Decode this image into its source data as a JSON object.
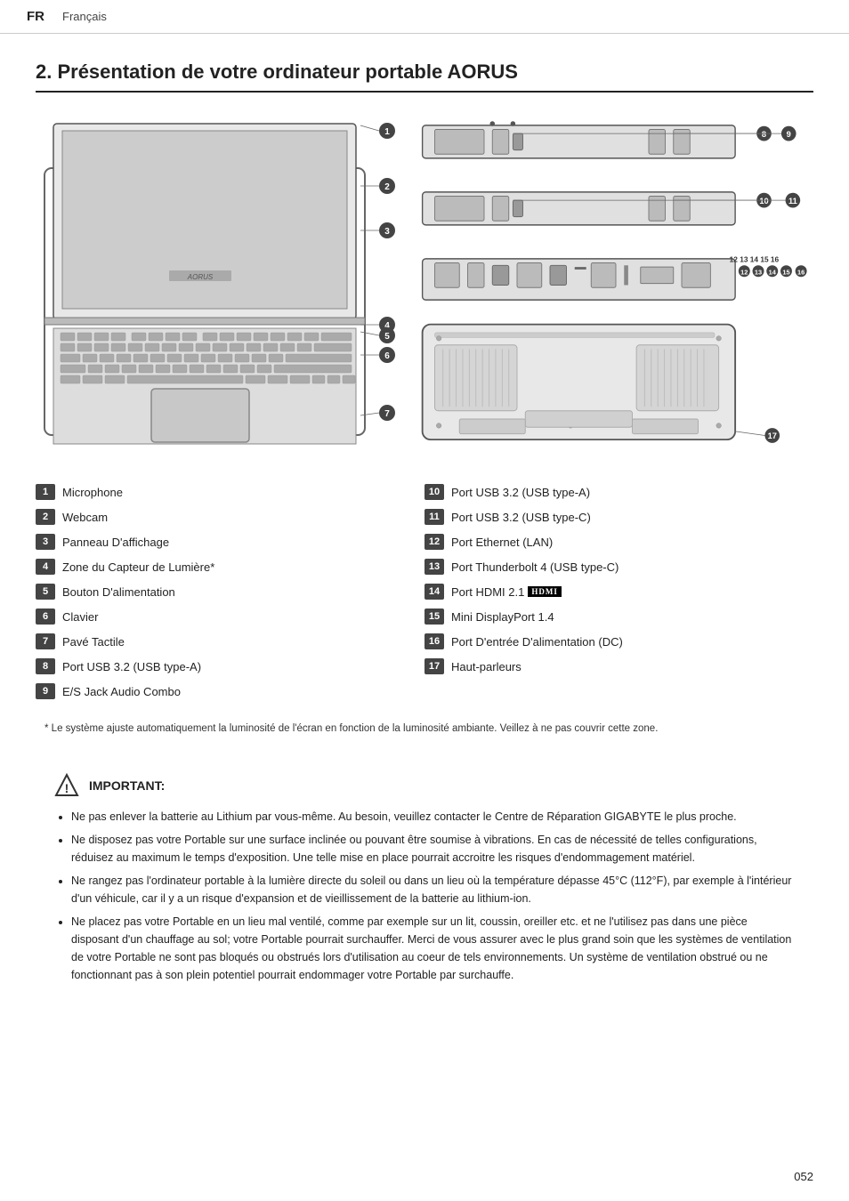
{
  "header": {
    "lang_code": "FR",
    "lang_name": "Français"
  },
  "section": {
    "title": "2. Présentation de votre ordinateur portable AORUS"
  },
  "labels": [
    {
      "num": "1",
      "text": "Microphone"
    },
    {
      "num": "10",
      "text": "Port USB 3.2 (USB type-A)"
    },
    {
      "num": "2",
      "text": "Webcam"
    },
    {
      "num": "11",
      "text": "Port USB 3.2 (USB type-C)"
    },
    {
      "num": "3",
      "text": "Panneau D'affichage"
    },
    {
      "num": "12",
      "text": "Port Ethernet (LAN)"
    },
    {
      "num": "4",
      "text": "Zone du Capteur de Lumière*"
    },
    {
      "num": "13",
      "text": "Port Thunderbolt 4 (USB type-C)"
    },
    {
      "num": "5",
      "text": "Bouton D'alimentation"
    },
    {
      "num": "14",
      "text": "Port HDMI 2.1",
      "hdmi": true
    },
    {
      "num": "6",
      "text": "Clavier"
    },
    {
      "num": "15",
      "text": "Mini DisplayPort 1.4"
    },
    {
      "num": "7",
      "text": "Pavé Tactile"
    },
    {
      "num": "16",
      "text": "Port D'entrée D'alimentation (DC)"
    },
    {
      "num": "8",
      "text": "Port USB 3.2 (USB type-A)"
    },
    {
      "num": "17",
      "text": "Haut-parleurs"
    },
    {
      "num": "9",
      "text": "E/S Jack Audio Combo"
    }
  ],
  "footnote": "* Le système ajuste automatiquement la luminosité de l'écran en fonction de la luminosité ambiante. Veillez à ne pas couvrir cette zone.",
  "important": {
    "title": "IMPORTANT:",
    "bullets": [
      "Ne pas enlever la batterie au Lithium par vous-même. Au besoin, veuillez contacter le Centre de Réparation GIGABYTE le plus proche.",
      "Ne disposez pas votre Portable sur une surface inclinée ou pouvant être soumise à vibrations. En cas de né­cessité de telles configurations, réduisez au maximum le temps d'exposition. Une telle mise en place pourrait accroitre les risques d'endommagement matériel.",
      "Ne rangez pas l'ordinateur portable à la lumière directe du soleil ou dans un lieu où la température dépasse 45°C (112°F), par exemple à l'intérieur d'un véhicule, car il y a un risque d'expansion et de vieillissement de la batterie au lithium-ion.",
      "Ne placez pas votre Portable en un lieu mal ventilé, comme par exemple sur un lit, coussin, oreiller etc. et ne l'utilisez pas dans une pièce disposant d'un chauffage au sol; votre Portable pourrait surchauffer. Merci de vous assurer avec le plus grand soin que les systèmes de ventilation de votre Portable ne sont pas bloqués ou obstrués lors d'utilisation au coeur de tels environnements. Un système de ventilation obstrué ou ne fonctionnant pas à son plein potentiel pourrait endommager votre Portable par surchauffe."
    ]
  },
  "page_number": "052"
}
